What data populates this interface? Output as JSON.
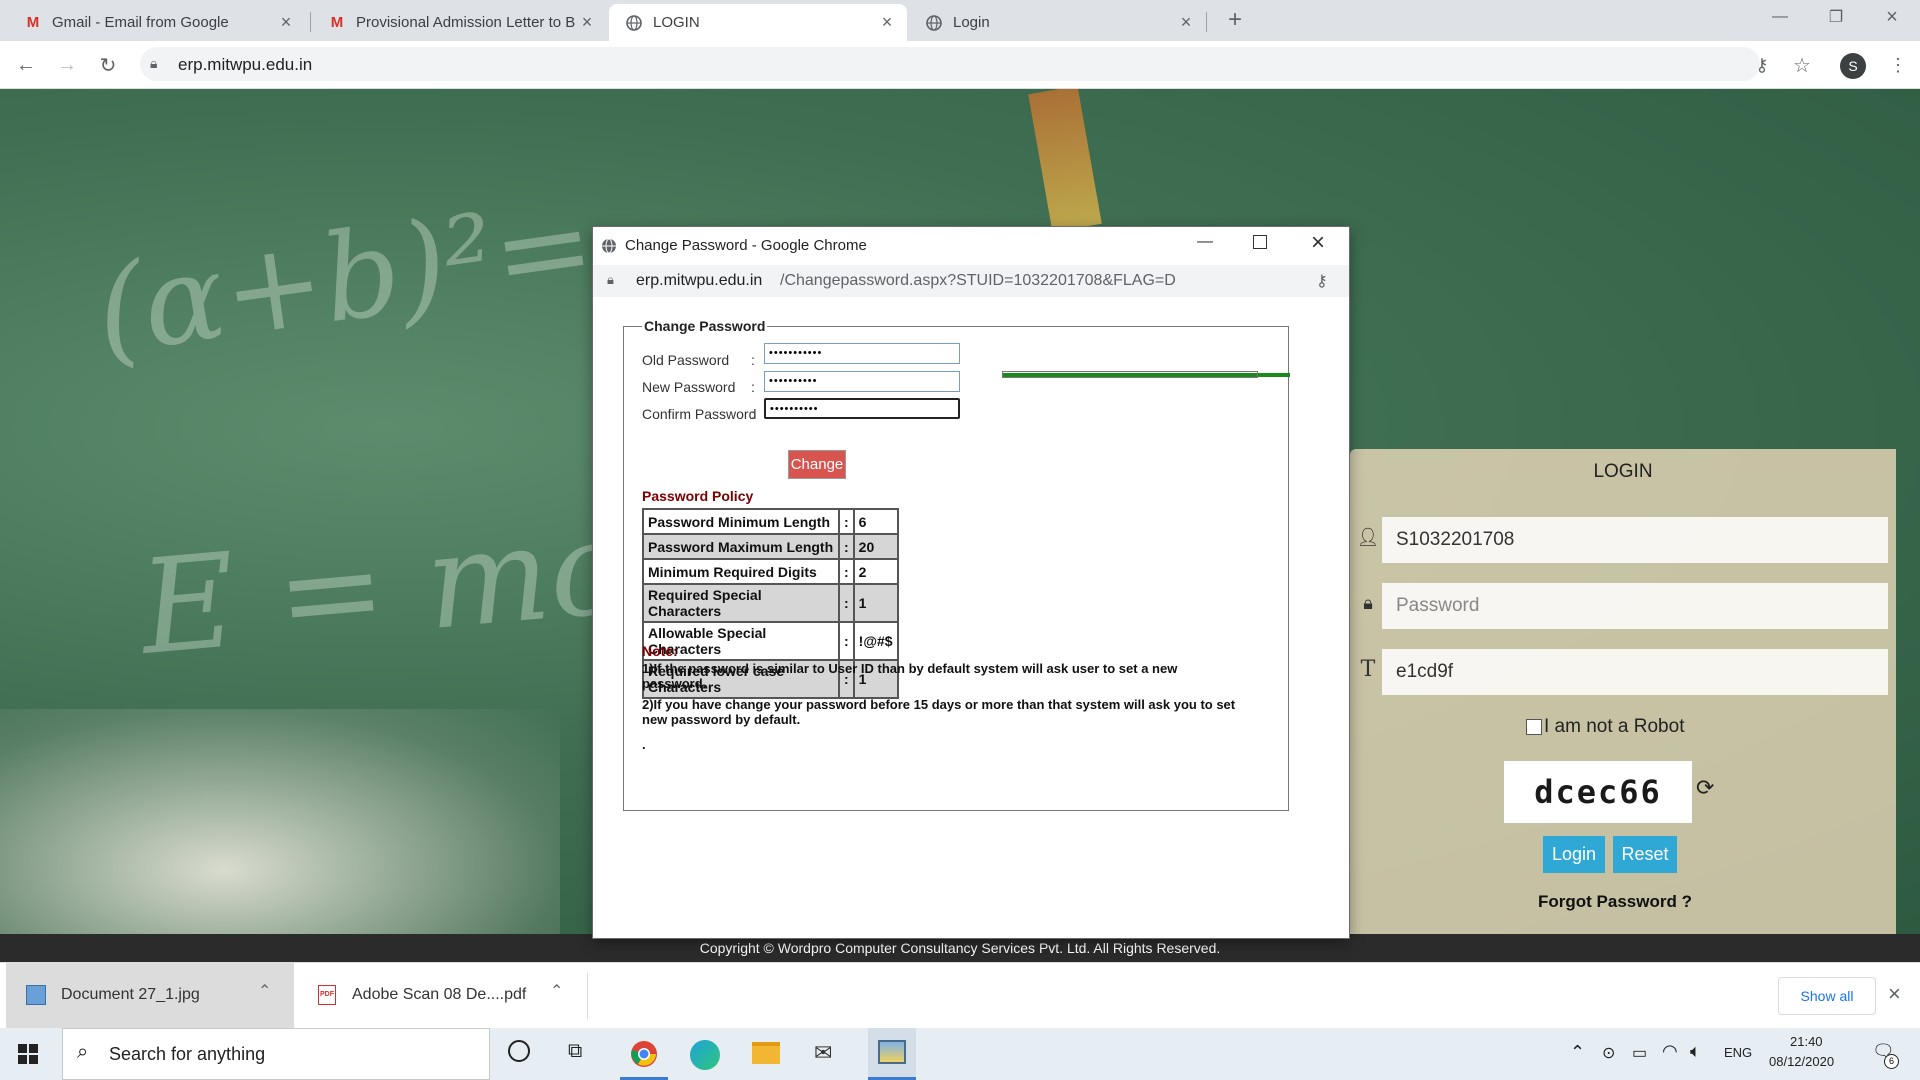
{
  "browser": {
    "tabs": [
      {
        "title": "Gmail - Email from Google",
        "icon": "gmail-icon"
      },
      {
        "title": "Provisional Admission Letter to B",
        "icon": "gmail-icon"
      },
      {
        "title": "LOGIN",
        "icon": "globe-icon"
      },
      {
        "title": "Login",
        "icon": "globe-icon"
      }
    ],
    "url": "erp.mitwpu.edu.in",
    "profile_initial": "S"
  },
  "login_panel": {
    "title": "LOGIN",
    "username_value": "S1032201708",
    "password_placeholder": "Password",
    "captcha_input_value": "e1cd9f",
    "robot_label": "I am not a Robot",
    "captcha_text": "dcec66",
    "login_button": "Login",
    "reset_button": "Reset",
    "forgot_link": "Forgot Password ?"
  },
  "footer": {
    "text": "Copyright © Wordpro Computer Consultancy Services Pvt. Ltd. All Rights Reserved."
  },
  "popup": {
    "window_title": "Change Password - Google Chrome",
    "url_host": "erp.mitwpu.edu.in",
    "url_path": "/Changepassword.aspx?STUID=1032201708&FLAG=D",
    "legend": "Change Password",
    "fields": [
      {
        "label": "Old Password",
        "colon": ":",
        "value": "•••••••••••"
      },
      {
        "label": "New Password",
        "colon": ":",
        "value": "••••••••••"
      },
      {
        "label": "Confirm Password",
        "colon": ":",
        "value": "••••••••••"
      }
    ],
    "strength_color": "#1a8a1a",
    "change_button": "Change",
    "policy_heading": "Password Policy",
    "policy": [
      {
        "name": "Password Minimum Length",
        "sep": ":",
        "value": "6"
      },
      {
        "name": "Password Maximum Length",
        "sep": ":",
        "value": "20"
      },
      {
        "name": "Minimum Required Digits",
        "sep": ":",
        "value": "2"
      },
      {
        "name": "Required Special Characters",
        "sep": ":",
        "value": "1"
      },
      {
        "name": "Allowable Special Characters",
        "sep": ":",
        "value": "!@#$"
      },
      {
        "name": "Required lower case Characters",
        "sep": ":",
        "value": "1"
      }
    ],
    "note_heading": "Note:",
    "note1": "1)If the password is similar to User ID than by default system will ask user to set a new password.",
    "note2": "2)If you have change your password before 15 days or more than that system will ask you to set new password by default.",
    "dot": "."
  },
  "downloads": {
    "items": [
      {
        "name": "Document 27_1.jpg",
        "icon": "image-file-icon"
      },
      {
        "name": "Adobe Scan 08 De....pdf",
        "icon": "pdf-file-icon"
      }
    ],
    "show_all": "Show all"
  },
  "taskbar": {
    "search_placeholder": "Search for anything",
    "language": "ENG",
    "time": "21:40",
    "date": "08/12/2020",
    "notification_count": "6"
  },
  "colors": {
    "accent_blue": "#2fa8d6",
    "change_button": "#d9534f",
    "policy_heading": "#7b0000"
  }
}
